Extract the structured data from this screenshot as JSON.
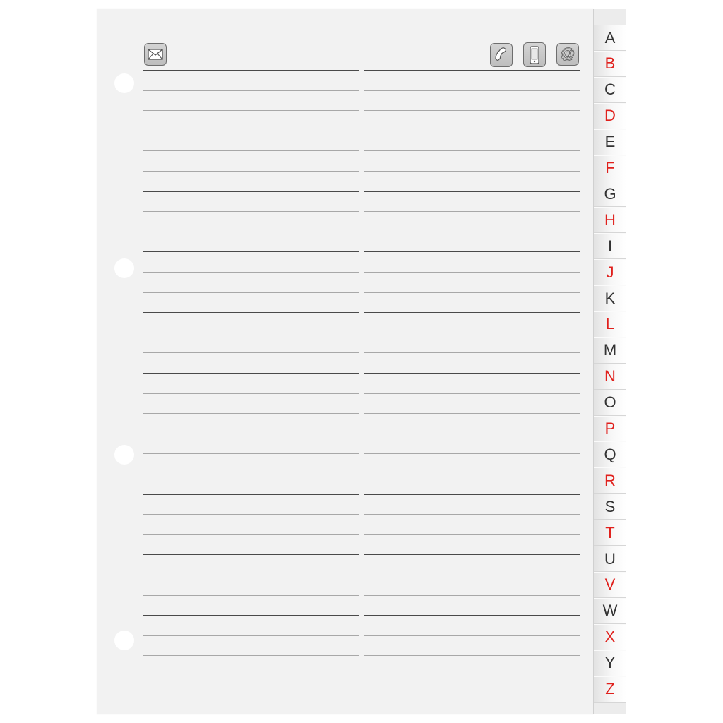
{
  "header": {
    "icons": [
      "envelope-icon",
      "phone-icon",
      "mobile-phone-icon",
      "at-sign-icon"
    ]
  },
  "index_tabs": [
    {
      "letter": "A",
      "color": "#333333"
    },
    {
      "letter": "B",
      "color": "#e0201c"
    },
    {
      "letter": "C",
      "color": "#333333"
    },
    {
      "letter": "D",
      "color": "#e0201c"
    },
    {
      "letter": "E",
      "color": "#333333"
    },
    {
      "letter": "F",
      "color": "#e0201c"
    },
    {
      "letter": "G",
      "color": "#333333"
    },
    {
      "letter": "H",
      "color": "#e0201c"
    },
    {
      "letter": "I",
      "color": "#333333"
    },
    {
      "letter": "J",
      "color": "#e0201c"
    },
    {
      "letter": "K",
      "color": "#333333"
    },
    {
      "letter": "L",
      "color": "#e0201c"
    },
    {
      "letter": "M",
      "color": "#333333"
    },
    {
      "letter": "N",
      "color": "#e0201c"
    },
    {
      "letter": "O",
      "color": "#333333"
    },
    {
      "letter": "P",
      "color": "#e0201c"
    },
    {
      "letter": "Q",
      "color": "#333333"
    },
    {
      "letter": "R",
      "color": "#e0201c"
    },
    {
      "letter": "S",
      "color": "#333333"
    },
    {
      "letter": "T",
      "color": "#e0201c"
    },
    {
      "letter": "U",
      "color": "#333333"
    },
    {
      "letter": "V",
      "color": "#e0201c"
    },
    {
      "letter": "W",
      "color": "#333333"
    },
    {
      "letter": "X",
      "color": "#e0201c"
    },
    {
      "letter": "Y",
      "color": "#333333"
    },
    {
      "letter": "Z",
      "color": "#e0201c"
    }
  ],
  "colors": {
    "page": "#f2f2f2",
    "tab_letter_black": "#333333",
    "tab_letter_red": "#e0201c"
  }
}
